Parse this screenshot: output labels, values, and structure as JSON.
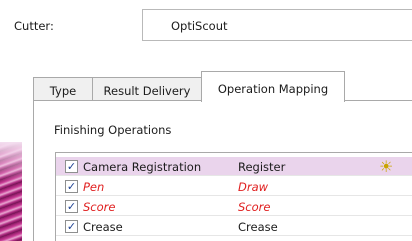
{
  "cutter": {
    "label": "Cutter:",
    "value": "OptiScout"
  },
  "tabs": [
    {
      "label": "Type",
      "active": false
    },
    {
      "label": "Result Delivery",
      "active": false
    },
    {
      "label": "Operation Mapping",
      "active": true
    }
  ],
  "finishing": {
    "group_label": "Finishing Operations",
    "rows": [
      {
        "checked": "✓",
        "name": "Camera Registration",
        "operation": "Register",
        "indicator": "sun-icon",
        "highlighted": true,
        "color": "#1b1b1b"
      },
      {
        "checked": "✓",
        "name": "Pen",
        "operation": "Draw",
        "highlighted": false,
        "color": "#e02020"
      },
      {
        "checked": "✓",
        "name": "Score",
        "operation": "Score",
        "highlighted": false,
        "color": "#e02020"
      },
      {
        "checked": "✓",
        "name": "Crease",
        "operation": "Crease",
        "highlighted": false,
        "color": "#1b1b1b"
      }
    ]
  },
  "icons": {
    "indicator_glyph": "☀"
  }
}
